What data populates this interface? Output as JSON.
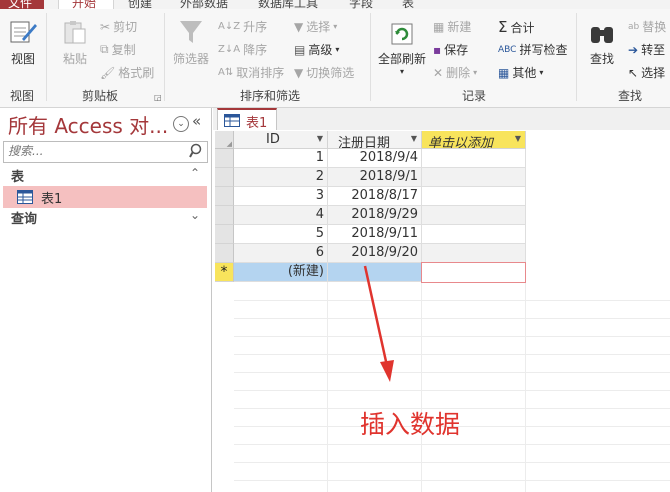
{
  "tabs": [
    "文件",
    "开始",
    "创建",
    "外部数据",
    "数据库工具",
    "字段",
    "表"
  ],
  "colors": {
    "accent": "#a4373a",
    "annotation": "#e0342e",
    "selected_row": "#f5c0c0",
    "new_row": "#b4d4f0",
    "add_column_header": "#f8e45c"
  },
  "ribbon": {
    "view": {
      "button": "视图",
      "group": "视图"
    },
    "clipboard": {
      "paste": "粘贴",
      "cut": "剪切",
      "copy": "复制",
      "format_painter": "格式刷",
      "group": "剪贴板"
    },
    "sort_filter": {
      "filter": "筛选器",
      "ascending": "升序",
      "descending": "降序",
      "remove_sort": "取消排序",
      "selection": "选择",
      "advanced": "高级",
      "toggle_filter": "切换筛选",
      "group": "排序和筛选"
    },
    "records": {
      "refresh_all": "全部刷新",
      "new": "新建",
      "save": "保存",
      "delete": "删除",
      "totals": "合计",
      "spelling": "拼写检查",
      "more": "其他",
      "group": "记录"
    },
    "find": {
      "find": "查找",
      "replace": "替换",
      "goto": "转至",
      "select": "选择",
      "group": "查找"
    }
  },
  "nav": {
    "title": "所有 Access 对...",
    "search_placeholder": "搜索...",
    "categories": [
      {
        "label": "表",
        "chevron": "⌃",
        "items": [
          {
            "label": "表1",
            "selected": true
          }
        ]
      },
      {
        "label": "查询",
        "chevron": "⌄",
        "items": []
      }
    ]
  },
  "document": {
    "tab_label": "表1",
    "columns": [
      "ID",
      "注册日期",
      "单击以添加"
    ],
    "rows": [
      {
        "id": "1",
        "date": "2018/9/4"
      },
      {
        "id": "2",
        "date": "2018/9/1"
      },
      {
        "id": "3",
        "date": "2018/8/17"
      },
      {
        "id": "4",
        "date": "2018/9/29"
      },
      {
        "id": "5",
        "date": "2018/9/11"
      },
      {
        "id": "6",
        "date": "2018/9/20"
      }
    ],
    "new_row_marker": "*",
    "new_row_label": "(新建)"
  },
  "annotation": "插入数据"
}
